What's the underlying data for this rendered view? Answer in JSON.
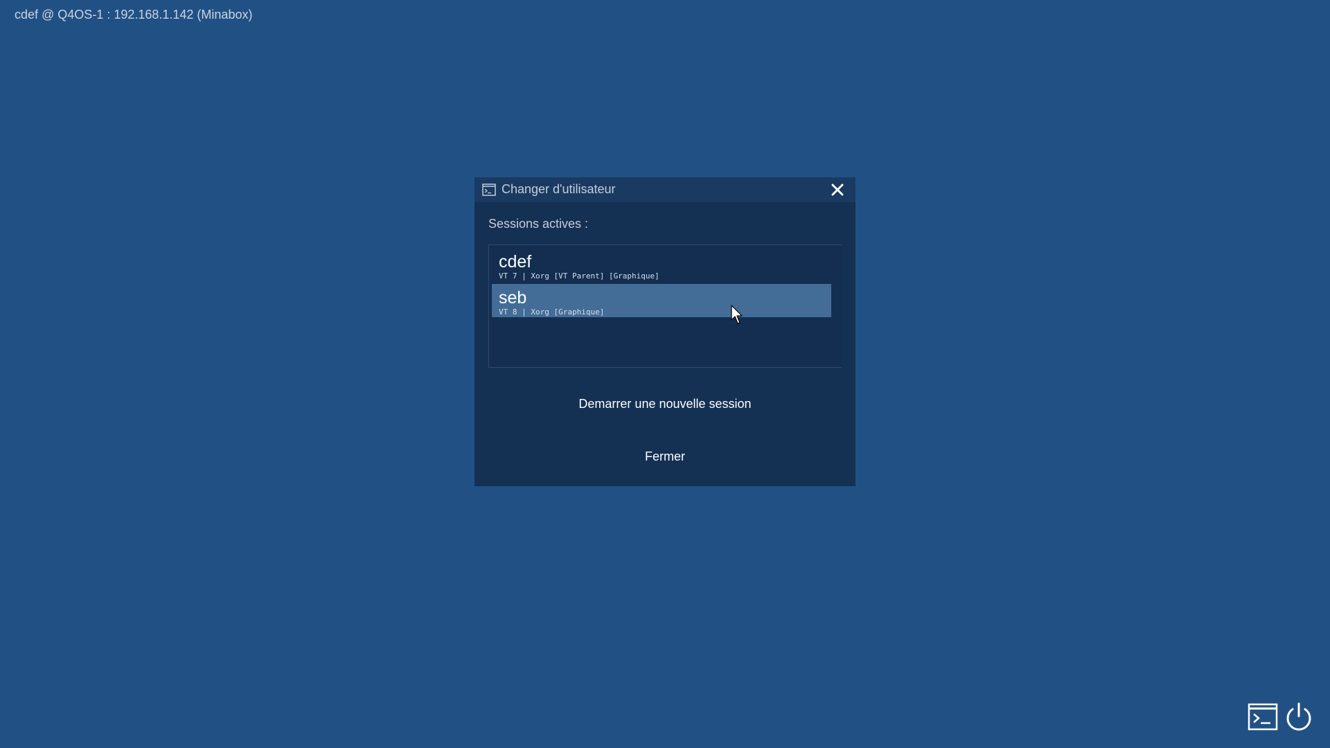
{
  "header": {
    "host_label": "cdef @ Q4OS-1 : 192.168.1.142 (Minabox)"
  },
  "dialog": {
    "title": "Changer d'utilisateur",
    "title_icon": "terminal-window-icon",
    "close_icon": "close-icon",
    "sessions_label": "Sessions actives :",
    "sessions": [
      {
        "name": "cdef",
        "detail": "VT 7 | Xorg [VT Parent] [Graphique]",
        "selected": false
      },
      {
        "name": "seb",
        "detail": "VT 8 | Xorg [Graphique]",
        "selected": true
      }
    ],
    "new_session_label": "Demarrer une nouvelle session",
    "close_label": "Fermer"
  },
  "bottom_bar": {
    "terminal_icon": "terminal-icon",
    "power_icon": "power-icon"
  },
  "colors": {
    "background": "#215184",
    "dialog_background": "#143053",
    "selected_item": "#436d97"
  }
}
